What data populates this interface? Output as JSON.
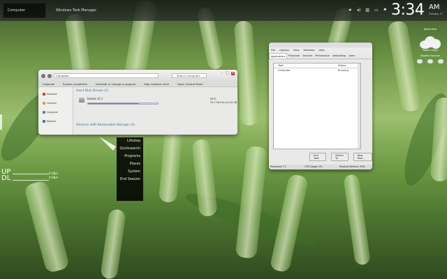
{
  "taskbar": {
    "tasks": [
      {
        "label": "Computer",
        "active": true
      },
      {
        "label": "Windows Task Manager",
        "active": false
      }
    ],
    "tray_icons": [
      "star-icon",
      "volume-icon",
      "network-icon",
      "monitor-icon",
      "flag-icon"
    ]
  },
  "clock": {
    "time": "3:34",
    "ampm": "AM",
    "date": "Tuesday, 6"
  },
  "explorer": {
    "address": "Computer",
    "search_placeholder": "Search Computer",
    "toolbar": [
      "Organize",
      "System properties",
      "Uninstall or change a program",
      "Map network drive",
      "Open Control Panel"
    ],
    "nav_items": [
      {
        "label": "Favorites",
        "color": "#d33"
      },
      {
        "label": "Libraries",
        "color": "#c8a040"
      },
      {
        "label": "Computer",
        "color": "#5a7fb0"
      },
      {
        "label": "Network",
        "color": "#4a70a0"
      }
    ],
    "hard_disk_header": "Hard Disk Drives (1)",
    "drive_name": "Home (C:)",
    "drive_fs": "NTFS",
    "drive_space": "59.1 GB free of 219 GB",
    "drive_used_fraction": 0.73,
    "removable_header": "Devices with Removable Storage (3)"
  },
  "task_manager": {
    "menus": [
      "File",
      "Options",
      "View",
      "Windows",
      "Help"
    ],
    "tabs": [
      "Applications",
      "Processes",
      "Services",
      "Performance",
      "Networking",
      "Users"
    ],
    "selected_tab": 0,
    "columns": [
      "Task",
      "Status"
    ],
    "rows": [
      {
        "task": "Computer",
        "status": "Running"
      }
    ],
    "buttons": [
      "End Task",
      "Switch To",
      "New Task..."
    ],
    "status": [
      "Processes: 71",
      "CPU Usage: 0%",
      "Physical Memory: 49%"
    ]
  },
  "start_menu": {
    "items": [
      "Lifestep",
      "Quicksearch",
      "Programs",
      "Places",
      "System",
      "End Session"
    ]
  },
  "net_meter": {
    "up_label": "UP",
    "down_label": "DL",
    "up_value": "0.0B/s",
    "down_value": "0.0B/s"
  },
  "weather": {
    "location": "Wheat field",
    "condition": "Mostly cloudy",
    "forecast_label": "Weather Forecast"
  }
}
